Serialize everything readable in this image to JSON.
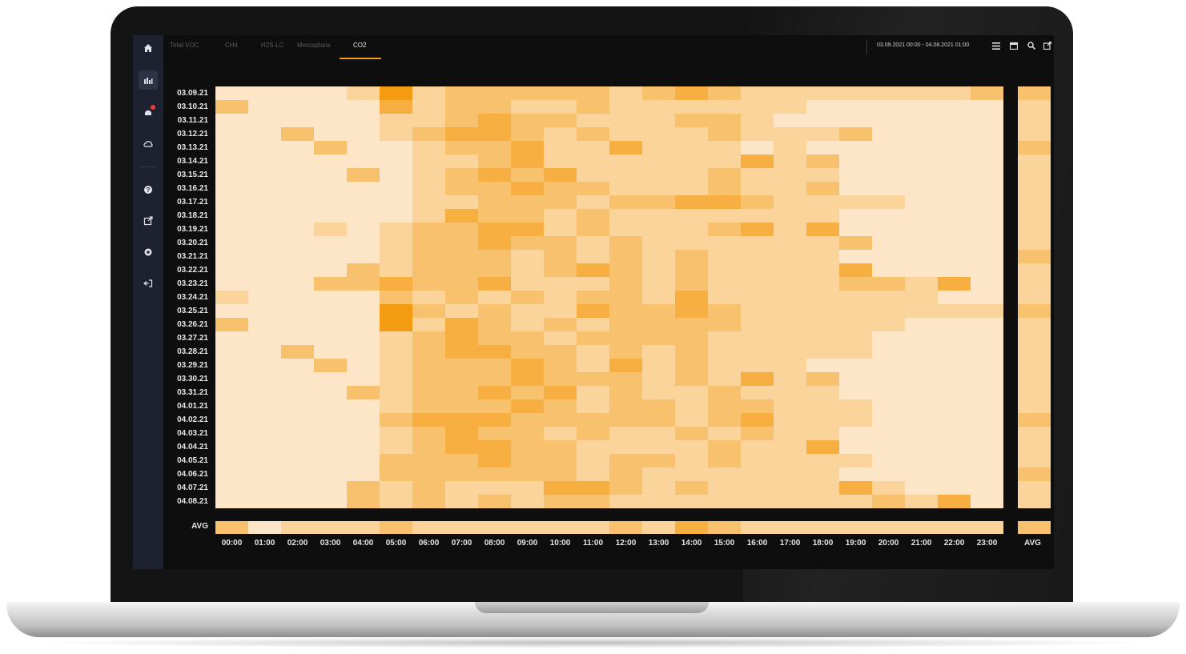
{
  "app": {
    "tabs": [
      {
        "label": "Total VOC",
        "active": false
      },
      {
        "label": "CH4",
        "active": false
      },
      {
        "label": "H2S-LC",
        "active": false
      },
      {
        "label": "Mercaptans",
        "active": false
      },
      {
        "label": "CO2",
        "active": true
      }
    ],
    "date_range": "03.09.2021 00:00 - 04.08.2021 01:00",
    "sidebar_icons": [
      "home-icon",
      "chart-icon",
      "alert-icon",
      "cloud-icon",
      "help-icon",
      "export-icon",
      "settings-icon",
      "logout-icon"
    ],
    "toolbar_icons": [
      "menu-icon",
      "calendar-icon",
      "search-icon",
      "export-icon"
    ],
    "accent_color": "#f39c12"
  },
  "chart_data": {
    "type": "heatmap",
    "rows": [
      "03.09.21",
      "03.10.21",
      "03.11.21",
      "03.12.21",
      "03.13.21",
      "03.14.21",
      "03.15.21",
      "03.16.21",
      "03.17.21",
      "03.18.21",
      "03.19.21",
      "03.20.21",
      "03.21.21",
      "03.22.21",
      "03.23.21",
      "03.24.21",
      "03.25.21",
      "03.26.21",
      "03.27.21",
      "03.28.21",
      "03.29.21",
      "03.30.21",
      "03.31.21",
      "04.01.21",
      "04.02.21",
      "04.03.21",
      "04.04.21",
      "04.05.21",
      "04.06.21",
      "04.07.21",
      "04.08.21"
    ],
    "columns": [
      "00:00",
      "01:00",
      "02:00",
      "03:00",
      "04:00",
      "05:00",
      "06:00",
      "07:00",
      "08:00",
      "09:00",
      "10:00",
      "11:00",
      "12:00",
      "13:00",
      "14:00",
      "15:00",
      "16:00",
      "17:00",
      "18:00",
      "19:00",
      "20:00",
      "21:00",
      "22:00",
      "23:00"
    ],
    "row_avg_label": "AVG",
    "col_avg_label": "AVG",
    "color_low": "#fde6c8",
    "color_high": "#f39c12",
    "values": [
      [
        1,
        1,
        1,
        1,
        2,
        5,
        2,
        3,
        3,
        3,
        3,
        3,
        2,
        3,
        4,
        3,
        2,
        2,
        2,
        2,
        2,
        2,
        2,
        3
      ],
      [
        3,
        1,
        1,
        1,
        1,
        4,
        2,
        3,
        3,
        2,
        2,
        3,
        2,
        2,
        2,
        2,
        2,
        2,
        1,
        1,
        1,
        1,
        1,
        1
      ],
      [
        1,
        1,
        1,
        1,
        1,
        2,
        2,
        3,
        4,
        3,
        3,
        2,
        2,
        2,
        3,
        3,
        2,
        1,
        1,
        1,
        1,
        1,
        1,
        1
      ],
      [
        1,
        1,
        3,
        1,
        1,
        2,
        3,
        4,
        4,
        3,
        2,
        3,
        2,
        2,
        2,
        3,
        2,
        2,
        2,
        3,
        1,
        1,
        1,
        1
      ],
      [
        1,
        1,
        1,
        3,
        1,
        1,
        2,
        3,
        3,
        4,
        2,
        2,
        4,
        2,
        2,
        2,
        1,
        2,
        1,
        1,
        1,
        1,
        1,
        1
      ],
      [
        1,
        1,
        1,
        1,
        1,
        1,
        2,
        2,
        3,
        4,
        2,
        2,
        2,
        2,
        2,
        2,
        4,
        2,
        3,
        1,
        1,
        1,
        1,
        1
      ],
      [
        1,
        1,
        1,
        1,
        3,
        1,
        2,
        3,
        4,
        3,
        4,
        2,
        2,
        2,
        2,
        3,
        2,
        2,
        2,
        1,
        1,
        1,
        1,
        1
      ],
      [
        1,
        1,
        1,
        1,
        1,
        1,
        2,
        3,
        3,
        4,
        3,
        3,
        2,
        2,
        2,
        3,
        2,
        2,
        3,
        1,
        1,
        1,
        1,
        1
      ],
      [
        1,
        1,
        1,
        1,
        1,
        1,
        2,
        2,
        3,
        3,
        3,
        2,
        3,
        3,
        4,
        4,
        3,
        2,
        2,
        2,
        2,
        1,
        1,
        1
      ],
      [
        1,
        1,
        1,
        1,
        1,
        1,
        2,
        4,
        3,
        3,
        2,
        3,
        2,
        2,
        2,
        2,
        2,
        2,
        2,
        1,
        1,
        1,
        1,
        1
      ],
      [
        1,
        1,
        1,
        2,
        1,
        2,
        3,
        3,
        4,
        4,
        2,
        3,
        2,
        2,
        2,
        3,
        4,
        2,
        4,
        1,
        1,
        1,
        1,
        1
      ],
      [
        1,
        1,
        1,
        1,
        1,
        2,
        3,
        3,
        4,
        3,
        3,
        2,
        3,
        2,
        2,
        2,
        2,
        2,
        2,
        3,
        1,
        1,
        1,
        1
      ],
      [
        1,
        1,
        1,
        1,
        1,
        2,
        3,
        3,
        3,
        2,
        3,
        2,
        3,
        2,
        3,
        2,
        2,
        2,
        2,
        1,
        1,
        1,
        1,
        1
      ],
      [
        1,
        1,
        1,
        1,
        3,
        2,
        3,
        3,
        3,
        2,
        3,
        4,
        3,
        2,
        3,
        2,
        2,
        2,
        2,
        4,
        1,
        1,
        1,
        1
      ],
      [
        1,
        1,
        1,
        3,
        3,
        4,
        3,
        3,
        4,
        2,
        2,
        2,
        3,
        2,
        3,
        2,
        2,
        2,
        2,
        3,
        3,
        2,
        4,
        1
      ],
      [
        2,
        1,
        1,
        1,
        1,
        3,
        2,
        3,
        2,
        3,
        2,
        3,
        3,
        2,
        4,
        2,
        2,
        2,
        2,
        2,
        2,
        2,
        1,
        1
      ],
      [
        1,
        1,
        1,
        1,
        1,
        5,
        3,
        2,
        3,
        2,
        2,
        4,
        3,
        3,
        4,
        3,
        2,
        2,
        2,
        2,
        2,
        2,
        2,
        2
      ],
      [
        3,
        1,
        1,
        1,
        1,
        5,
        2,
        4,
        3,
        2,
        3,
        2,
        3,
        3,
        3,
        3,
        2,
        2,
        2,
        2,
        2,
        1,
        1,
        1
      ],
      [
        1,
        1,
        1,
        1,
        1,
        2,
        3,
        4,
        3,
        3,
        2,
        3,
        3,
        3,
        3,
        2,
        2,
        2,
        2,
        2,
        1,
        1,
        1,
        1
      ],
      [
        1,
        1,
        3,
        1,
        1,
        2,
        3,
        4,
        4,
        3,
        3,
        2,
        3,
        2,
        3,
        2,
        2,
        2,
        2,
        2,
        1,
        1,
        1,
        1
      ],
      [
        1,
        1,
        1,
        3,
        1,
        2,
        3,
        3,
        3,
        4,
        3,
        2,
        4,
        2,
        3,
        2,
        2,
        2,
        1,
        1,
        1,
        1,
        1,
        1
      ],
      [
        1,
        1,
        1,
        1,
        1,
        2,
        3,
        3,
        3,
        4,
        3,
        3,
        3,
        2,
        3,
        2,
        4,
        2,
        3,
        1,
        1,
        1,
        1,
        1
      ],
      [
        1,
        1,
        1,
        1,
        3,
        2,
        3,
        3,
        4,
        3,
        4,
        2,
        3,
        2,
        2,
        3,
        2,
        2,
        2,
        1,
        1,
        1,
        1,
        1
      ],
      [
        1,
        1,
        1,
        1,
        1,
        2,
        3,
        3,
        3,
        4,
        3,
        2,
        3,
        3,
        2,
        3,
        3,
        2,
        2,
        2,
        1,
        1,
        1,
        1
      ],
      [
        1,
        1,
        1,
        1,
        1,
        3,
        4,
        4,
        4,
        3,
        3,
        3,
        3,
        3,
        2,
        3,
        4,
        2,
        2,
        2,
        1,
        1,
        1,
        1
      ],
      [
        1,
        1,
        1,
        1,
        1,
        2,
        3,
        4,
        3,
        3,
        2,
        3,
        2,
        2,
        3,
        2,
        3,
        2,
        2,
        1,
        1,
        1,
        1,
        1
      ],
      [
        1,
        1,
        1,
        1,
        1,
        2,
        3,
        4,
        4,
        3,
        3,
        2,
        2,
        2,
        2,
        3,
        2,
        2,
        4,
        1,
        1,
        1,
        1,
        1
      ],
      [
        1,
        1,
        1,
        1,
        1,
        3,
        3,
        3,
        4,
        3,
        3,
        2,
        3,
        3,
        2,
        3,
        2,
        2,
        2,
        2,
        1,
        1,
        1,
        1
      ],
      [
        1,
        1,
        1,
        1,
        1,
        3,
        3,
        3,
        3,
        3,
        3,
        2,
        3,
        2,
        2,
        2,
        2,
        2,
        2,
        1,
        1,
        1,
        1,
        1
      ],
      [
        1,
        1,
        1,
        1,
        3,
        2,
        3,
        2,
        2,
        2,
        4,
        4,
        3,
        2,
        3,
        2,
        2,
        2,
        2,
        4,
        2,
        1,
        1,
        1
      ],
      [
        1,
        1,
        1,
        1,
        3,
        2,
        3,
        2,
        3,
        2,
        3,
        3,
        2,
        2,
        2,
        2,
        2,
        2,
        2,
        2,
        3,
        2,
        4,
        1
      ]
    ],
    "col_avg": [
      3,
      1,
      2,
      2,
      2,
      3,
      2,
      2,
      2,
      2,
      2,
      2,
      3,
      2,
      4,
      3,
      2,
      2,
      2,
      2,
      2,
      2,
      2,
      2
    ],
    "row_avg": [
      3,
      2,
      2,
      2,
      3,
      2,
      2,
      2,
      2,
      2,
      2,
      2,
      3,
      2,
      2,
      2,
      3,
      2,
      2,
      2,
      2,
      2,
      2,
      2,
      3,
      2,
      2,
      2,
      3,
      2,
      2
    ]
  }
}
